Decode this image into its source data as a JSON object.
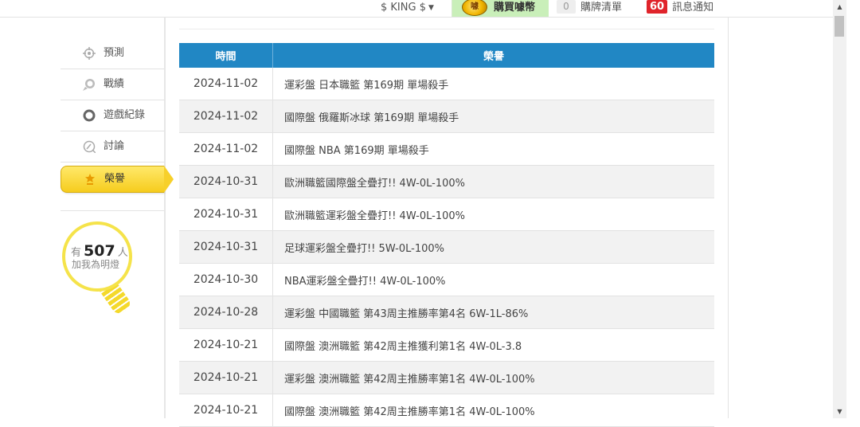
{
  "topbar": {
    "user_name": "$ KING $",
    "buy_coins_label": "購買噱幣",
    "cart_count": "0",
    "cart_label": "購牌清單",
    "notify_count": "60",
    "notify_label": "訊息通知"
  },
  "sidebar": {
    "items": [
      {
        "label": "預測",
        "icon": "crosshair-icon"
      },
      {
        "label": "戰績",
        "icon": "chat-bubble-icon"
      },
      {
        "label": "遊戲紀錄",
        "icon": "ring-icon"
      },
      {
        "label": "討論",
        "icon": "comment-icon"
      },
      {
        "label": "榮譽",
        "icon": "medal-icon",
        "active": true
      }
    ],
    "fans": {
      "prefix": "有",
      "count": "507",
      "suffix": "人",
      "subtext": "加我為明燈"
    }
  },
  "table": {
    "headers": [
      "時間",
      "榮譽"
    ],
    "rows": [
      {
        "date": "2024-11-02",
        "title": "運彩盤 日本職籃 第169期 單場殺手"
      },
      {
        "date": "2024-11-02",
        "title": "國際盤 俄羅斯冰球 第169期 單場殺手"
      },
      {
        "date": "2024-11-02",
        "title": "國際盤 NBA 第169期 單場殺手"
      },
      {
        "date": "2024-10-31",
        "title": "歐洲職籃國際盤全疊打!! 4W-0L-100%"
      },
      {
        "date": "2024-10-31",
        "title": "歐洲職籃運彩盤全疊打!! 4W-0L-100%"
      },
      {
        "date": "2024-10-31",
        "title": "足球運彩盤全疊打!! 5W-0L-100%"
      },
      {
        "date": "2024-10-30",
        "title": "NBA運彩盤全疊打!! 4W-0L-100%"
      },
      {
        "date": "2024-10-28",
        "title": "運彩盤 中國職籃 第43周主推勝率第4名 6W-1L-86%"
      },
      {
        "date": "2024-10-21",
        "title": "國際盤 澳洲職籃 第42周主推獲利第1名 4W-0L-3.8"
      },
      {
        "date": "2024-10-21",
        "title": "運彩盤 澳洲職籃 第42周主推勝率第1名 4W-0L-100%"
      },
      {
        "date": "2024-10-21",
        "title": "國際盤 澳洲職籃 第42周主推勝率第1名 4W-0L-100%"
      }
    ]
  },
  "colors": {
    "header_blue": "#2187c4",
    "active_yellow": "#f6cc1d",
    "badge_red": "#e0242b",
    "buy_green": "#c9efb9"
  }
}
